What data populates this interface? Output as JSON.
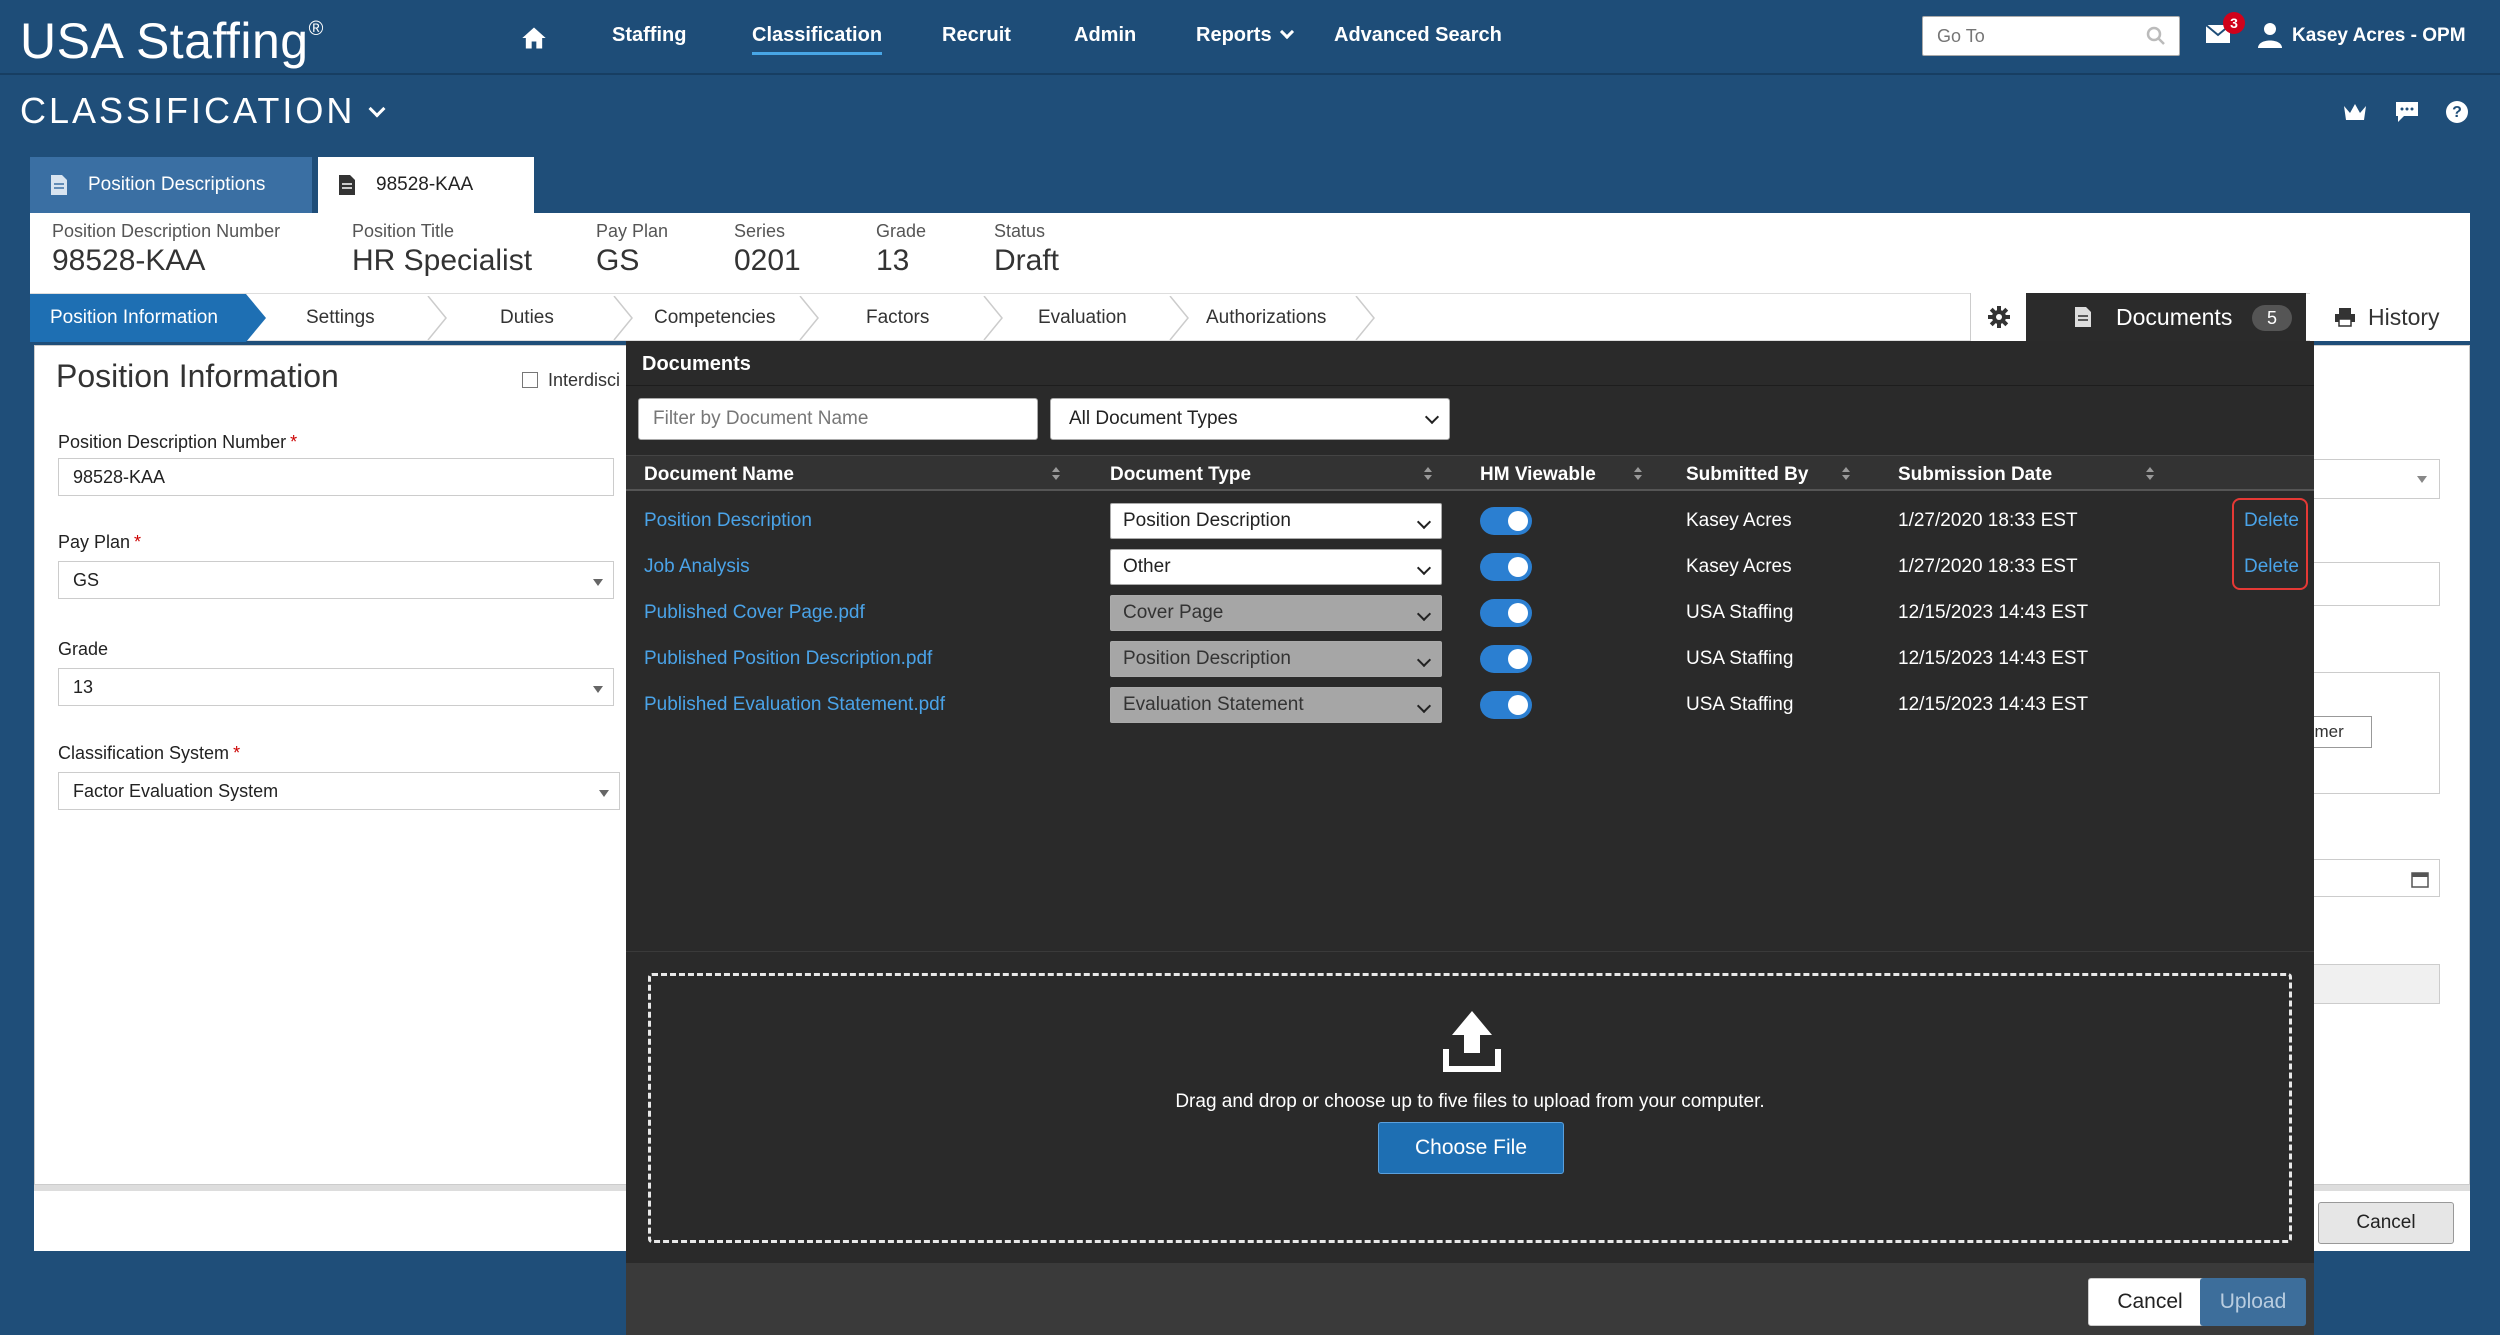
{
  "topnav": {
    "logo": "USA Staffing",
    "logo_mark": "®",
    "home_icon": "home-icon",
    "items": [
      {
        "label": "Staffing"
      },
      {
        "label": "Classification"
      },
      {
        "label": "Recruit"
      },
      {
        "label": "Admin"
      },
      {
        "label": "Reports"
      },
      {
        "label": "Advanced Search"
      }
    ],
    "goto_placeholder": "Go To",
    "mail_count": "3",
    "user": "Kasey Acres - OPM"
  },
  "module": {
    "title": "CLASSIFICATION",
    "header_icons": [
      "crown-icon",
      "chat-icon",
      "help-icon"
    ]
  },
  "record_tabs": {
    "list_label": "Position Descriptions",
    "record_label": "98528-KAA"
  },
  "summary": {
    "fields": [
      {
        "label": "Position Description Number",
        "value": "98528-KAA"
      },
      {
        "label": "Position Title",
        "value": "HR Specialist"
      },
      {
        "label": "Pay Plan",
        "value": "GS"
      },
      {
        "label": "Series",
        "value": "0201"
      },
      {
        "label": "Grade",
        "value": "13"
      },
      {
        "label": "Status",
        "value": "Draft"
      }
    ]
  },
  "steps": [
    {
      "label": "Position Information"
    },
    {
      "label": "Settings"
    },
    {
      "label": "Duties"
    },
    {
      "label": "Competencies"
    },
    {
      "label": "Factors"
    },
    {
      "label": "Evaluation"
    },
    {
      "label": "Authorizations"
    }
  ],
  "side_tabs": {
    "documents_label": "Documents",
    "documents_count": "5",
    "history_label": "History"
  },
  "form": {
    "title": "Position Information",
    "interdisciplinary_label": "Interdisci",
    "fields": [
      {
        "label": "Position Description Number",
        "value": "98528-KAA",
        "required": "*"
      },
      {
        "label": "Pay Plan",
        "value": "GS",
        "required": "*"
      },
      {
        "label": "Grade",
        "value": "13",
        "required": ""
      },
      {
        "label": "Classification System",
        "value": "Factor Evaluation System",
        "required": "*"
      }
    ],
    "right_fragment": "omer",
    "cancel_label": "Cancel"
  },
  "modal": {
    "title": "Documents",
    "filter_placeholder": "Filter by Document Name",
    "type_filter": "All Document Types",
    "columns": {
      "name": "Document Name",
      "type": "Document Type",
      "hm": "HM Viewable",
      "submitted_by": "Submitted By",
      "date": "Submission Date"
    },
    "rows": [
      {
        "name": "Position Description",
        "type": "Position Description",
        "hm_viewable": true,
        "submitted_by": "Kasey Acres",
        "date": "1/27/2020 18:33 EST",
        "action": "Delete"
      },
      {
        "name": "Job Analysis",
        "type": "Other",
        "hm_viewable": true,
        "submitted_by": "Kasey Acres",
        "date": "1/27/2020 18:33 EST",
        "action": "Delete"
      },
      {
        "name": "Published Cover Page.pdf",
        "type": "Cover Page",
        "hm_viewable": true,
        "submitted_by": "USA Staffing",
        "date": "12/15/2023 14:43 EST",
        "action": ""
      },
      {
        "name": "Published Position Description.pdf",
        "type": "Position Description",
        "hm_viewable": true,
        "submitted_by": "USA Staffing",
        "date": "12/15/2023 14:43 EST",
        "action": ""
      },
      {
        "name": "Published Evaluation Statement.pdf",
        "type": "Evaluation Statement",
        "hm_viewable": true,
        "submitted_by": "USA Staffing",
        "date": "12/15/2023 14:43 EST",
        "action": ""
      }
    ],
    "drop_text": "Drag and drop or choose up to five files to upload from your computer.",
    "choose_label": "Choose File",
    "cancel_label": "Cancel",
    "upload_label": "Upload"
  },
  "colors": {
    "nav_bg": "#1e4d78",
    "accent": "#1e6fb3",
    "link": "#4aa3e8",
    "highlight": "#e53935"
  }
}
